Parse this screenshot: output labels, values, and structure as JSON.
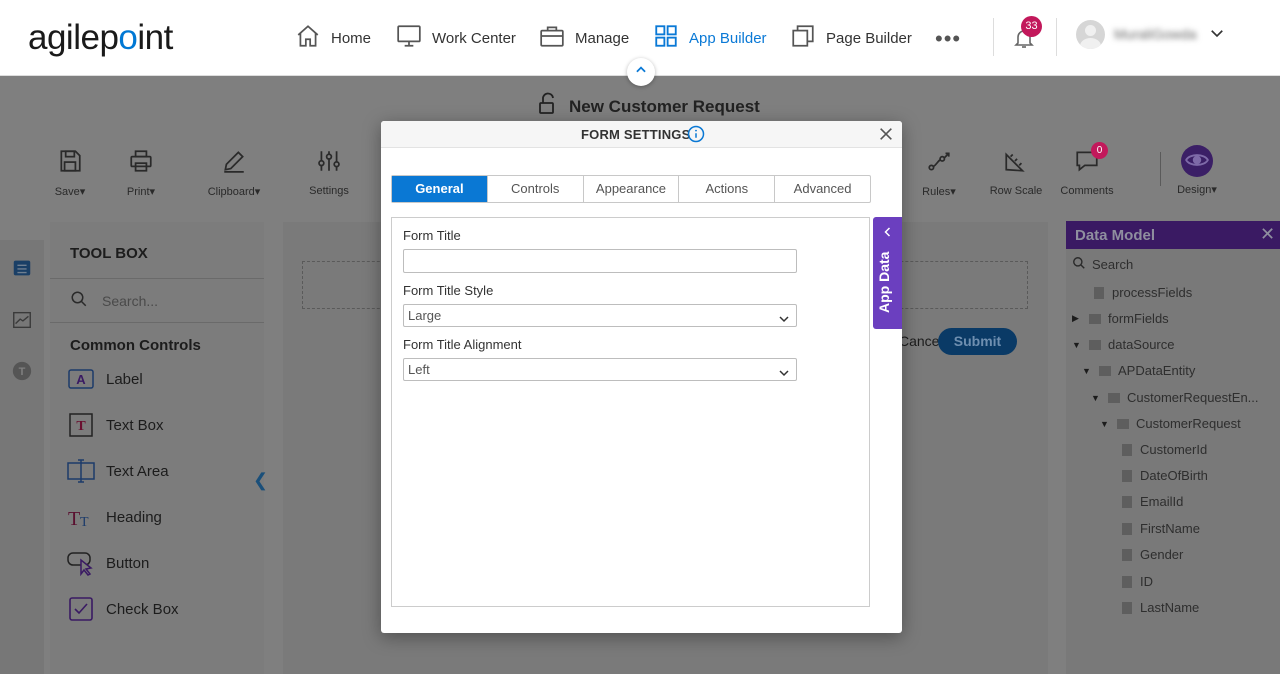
{
  "brand": {
    "logo_text": "agilepoint"
  },
  "nav": {
    "items": [
      {
        "label": "Home"
      },
      {
        "label": "Work Center"
      },
      {
        "label": "Manage"
      },
      {
        "label": "App Builder"
      },
      {
        "label": "Page Builder"
      }
    ],
    "more": "•••",
    "notifications_count": "33",
    "user_name": "MuraliGowda"
  },
  "page": {
    "title": "New Customer Request"
  },
  "toolbar": {
    "save": "Save",
    "print": "Print",
    "clipboard": "Clipboard",
    "settings": "Settings",
    "rules": "Rules",
    "row_scale": "Row Scale",
    "comments": "Comments",
    "comments_count": "0",
    "design": "Design"
  },
  "toolbox": {
    "title": "TOOL BOX",
    "search_placeholder": "Search...",
    "section": "Common Controls",
    "controls": [
      {
        "label": "Label"
      },
      {
        "label": "Text Box"
      },
      {
        "label": "Text Area"
      },
      {
        "label": "Heading"
      },
      {
        "label": "Button"
      },
      {
        "label": "Check Box"
      }
    ]
  },
  "canvas": {
    "cancel_label": "Cancel",
    "submit_label": "Submit"
  },
  "data_model": {
    "title": "Data Model",
    "search_placeholder": "Search",
    "nodes": [
      {
        "label": "processFields"
      },
      {
        "label": "formFields"
      },
      {
        "label": "dataSource"
      },
      {
        "label": "APDataEntity"
      },
      {
        "label": "CustomerRequestEn..."
      },
      {
        "label": "CustomerRequest"
      },
      {
        "label": "CustomerId"
      },
      {
        "label": "DateOfBirth"
      },
      {
        "label": "EmailId"
      },
      {
        "label": "FirstName"
      },
      {
        "label": "Gender"
      },
      {
        "label": "ID"
      },
      {
        "label": "LastName"
      }
    ]
  },
  "modal": {
    "title": "FORM SETTINGS",
    "tabs": [
      {
        "label": "General"
      },
      {
        "label": "Controls"
      },
      {
        "label": "Appearance"
      },
      {
        "label": "Actions"
      },
      {
        "label": "Advanced"
      }
    ],
    "form_title_label": "Form Title",
    "form_title_value": "",
    "form_title_style_label": "Form Title Style",
    "form_title_style_value": "Large",
    "form_title_alignment_label": "Form Title Alignment",
    "form_title_alignment_value": "Left"
  },
  "app_data": {
    "label": "App Data"
  },
  "colors": {
    "accent": "#0a78d4",
    "purple": "#6b3fbf",
    "badge": "#c2185b"
  }
}
